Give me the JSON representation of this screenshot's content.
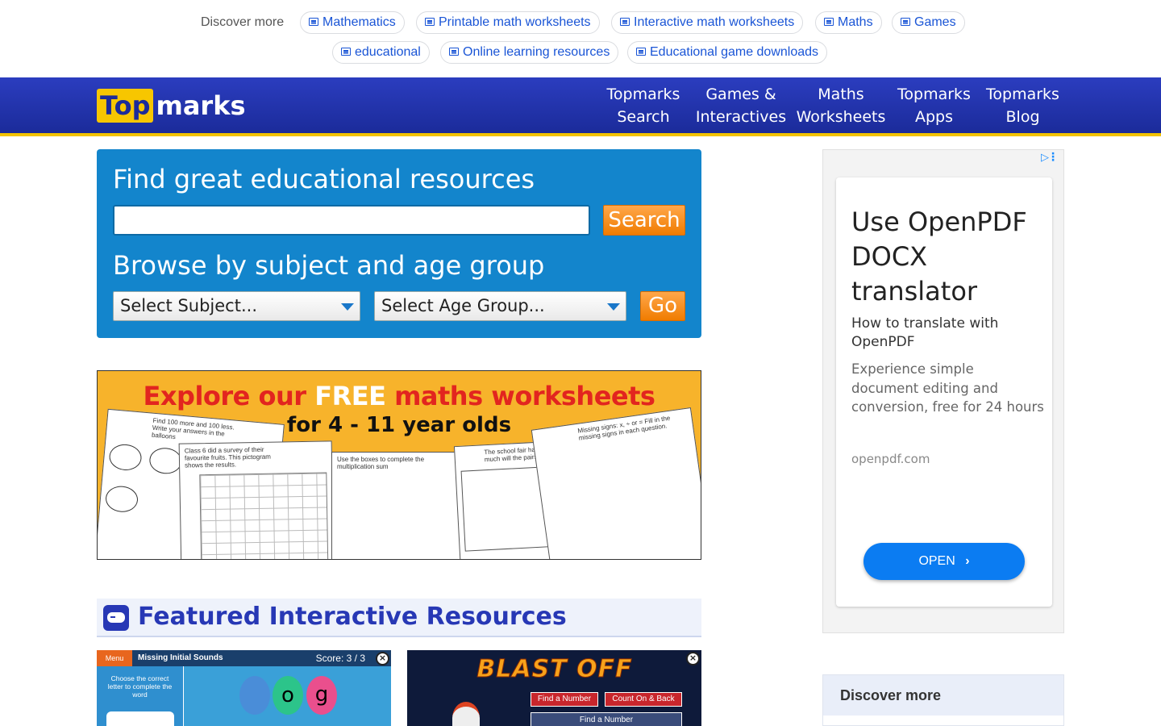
{
  "discover": {
    "label": "Discover more",
    "chips": [
      "Mathematics",
      "Printable math worksheets",
      "Interactive math worksheets",
      "Maths",
      "Games",
      "educational",
      "Online learning resources",
      "Educational game downloads"
    ]
  },
  "header": {
    "logo_top": "Top",
    "logo_marks": "marks",
    "nav": [
      {
        "line1": "Topmarks",
        "line2": "Search"
      },
      {
        "line1": "Games &",
        "line2": "Interactives"
      },
      {
        "line1": "Maths",
        "line2": "Worksheets"
      },
      {
        "line1": "Topmarks",
        "line2": "Apps"
      },
      {
        "line1": "Topmarks",
        "line2": "Blog"
      }
    ]
  },
  "search": {
    "title": "Find great educational resources",
    "input_value": "",
    "button": "Search",
    "browse_title": "Browse by subject and age group",
    "subject_select": "Select Subject...",
    "age_select": "Select Age Group...",
    "go_button": "Go"
  },
  "banner": {
    "line1_a": "Explore our ",
    "line1_free": "FREE",
    "line1_b": " maths worksheets",
    "line2": "for 4 - 11 year olds",
    "sheet1": "Find 100 more and 100 less. Write your answers in the balloons",
    "sheet2": "Class 6 did a survey of their favourite fruits. This pictogram shows the results.",
    "sheet3": "Use the boxes to complete the multiplication sum",
    "sheet4": "The school fair has a toy stall. How much will the pairs of toys cost?",
    "sheet5": "Missing signs: x, ÷ or = Fill in the missing signs in each question."
  },
  "featured": {
    "title": "Featured Interactive Resources",
    "thumb1_menu": "Menu",
    "thumb1_title": "Missing Initial Sounds",
    "thumb1_score": "Score: 3 / 3",
    "thumb1_instr": "Choose the correct letter to complete the word",
    "thumb1_letters": [
      "o",
      "g"
    ],
    "thumb2_title": "BLAST OFF",
    "thumb2_btn1": "Find a Number",
    "thumb2_btn2": "Count On & Back",
    "thumb2_btn3": "Find a Number"
  },
  "ad": {
    "title": "Use OpenPDF DOCX translator",
    "subtitle": "How to translate with OpenPDF",
    "description": "Experience simple document editing and conversion, free for 24 hours",
    "url": "openpdf.com",
    "button": "OPEN"
  },
  "sidebar_discover": {
    "label": "Discover more"
  },
  "colors": {
    "header_blue": "#1b2b9a",
    "panel_blue": "#1385cc",
    "accent_orange": "#f07c00",
    "logo_yellow": "#f7c600"
  }
}
